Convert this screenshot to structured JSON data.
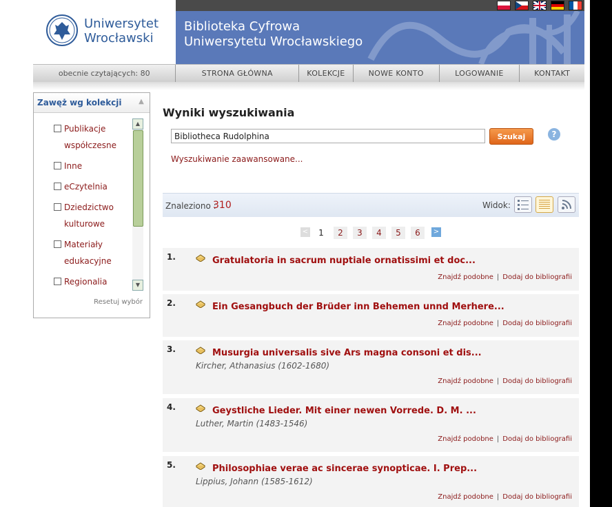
{
  "header": {
    "university_line1": "Uniwersytet",
    "university_line2": "Wrocławski",
    "title_line1": "Biblioteka Cyfrowa",
    "title_line2": "Uniwersytetu Wrocławskiego",
    "flags": [
      "pl",
      "cz",
      "en",
      "de",
      "fr"
    ]
  },
  "nav": {
    "readers": "obecnie czytających: 80",
    "items": [
      "STRONA GŁÓWNA",
      "KOLEKCJE",
      "NOWE KONTO",
      "LOGOWANIE",
      "KONTAKT"
    ]
  },
  "sidebar": {
    "title": "Zawęż wg kolekcji",
    "collections": [
      {
        "line1": "Publikacje",
        "line2": "współczesne"
      },
      {
        "line1": "Inne",
        "line2": ""
      },
      {
        "line1": "eCzytelnia",
        "line2": ""
      },
      {
        "line1": "Dziedzictwo",
        "line2": "kulturowe"
      },
      {
        "line1": "Materiały",
        "line2": "edukacyjne"
      },
      {
        "line1": "Regionalia",
        "line2": ""
      }
    ],
    "reset": "Resetuj wybór"
  },
  "search": {
    "heading": "Wyniki wyszukiwania",
    "query": "Bibliotheca Rudolphina",
    "button": "Szukaj",
    "help": "?",
    "advanced": "Wyszukiwanie zaawansowane..."
  },
  "results_bar": {
    "found_label": "Znaleziono :",
    "found_count": "310",
    "view_label": "Widok:"
  },
  "pager": {
    "current": "1",
    "pages": [
      "2",
      "3",
      "4",
      "5",
      "6"
    ]
  },
  "results": [
    {
      "num": "1.",
      "title": "Gratulatoria in sacrum nuptiale ornatissimi et doc...",
      "author": ""
    },
    {
      "num": "2.",
      "title": "Ein Gesangbuch der Brüder inn Behemen unnd Merhere...",
      "author": ""
    },
    {
      "num": "3.",
      "title": "Musurgia universalis sive Ars magna consoni et dis...",
      "author": "Kircher, Athanasius (1602-1680)"
    },
    {
      "num": "4.",
      "title": "Geystliche Lieder. Mit einer newen Vorrede. D. M. ...",
      "author": "Luther, Martin (1483-1546)"
    },
    {
      "num": "5.",
      "title": "Philosophiae verae ac sincerae synopticae. I. Prep...",
      "author": "Lippius, Johann (1585-1612)"
    }
  ],
  "result_links": {
    "similar": "Znajdź podobne",
    "sep": "|",
    "add": "Dodaj do bibliografii"
  },
  "colors": {
    "brand_blue": "#5a79b9",
    "link_red": "#a01010",
    "button_orange": "#e0661a"
  }
}
